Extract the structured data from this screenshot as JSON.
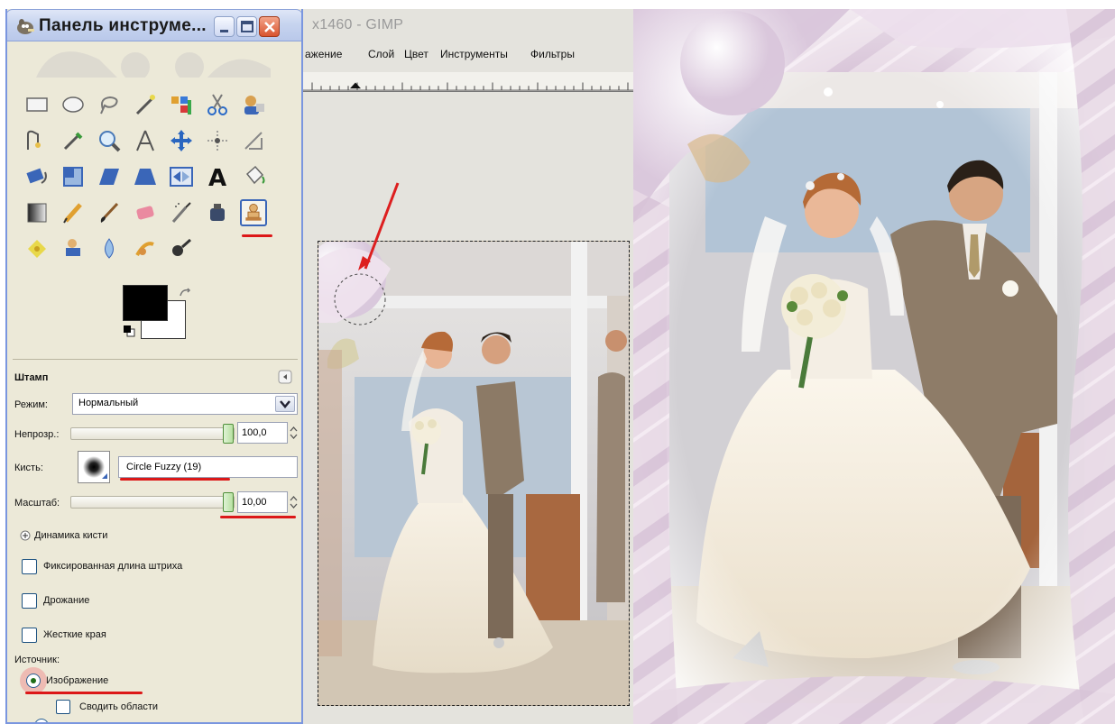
{
  "toolbox": {
    "title": "Панель инструме...",
    "tool_name": "Штамп",
    "mode_label": "Режим:",
    "mode_value": "Нормальный",
    "opacity_label": "Непрозр.:",
    "opacity_value": "100,0",
    "brush_label": "Кисть:",
    "brush_value": "Circle Fuzzy (19)",
    "scale_label": "Масштаб:",
    "scale_value": "10,00",
    "dynamics_label": "Динамика кисти",
    "fixed_stroke_label": "Фиксированная длина штриха",
    "jitter_label": "Дрожание",
    "hard_edges_label": "Жесткие края",
    "source_label": "Источник:",
    "source_image_label": "Изображение",
    "merge_label": "Сводить области",
    "opacity_fraction": 1.0,
    "scale_fraction": 1.0
  },
  "image_window": {
    "title": "x1460 - GIMP",
    "menu": [
      "ажение",
      "Слой",
      "Цвет",
      "Инструменты",
      "Фильтры"
    ]
  },
  "colors": {
    "foreground": "#000000",
    "background": "#ffffff",
    "highlight": "#dc1818"
  }
}
